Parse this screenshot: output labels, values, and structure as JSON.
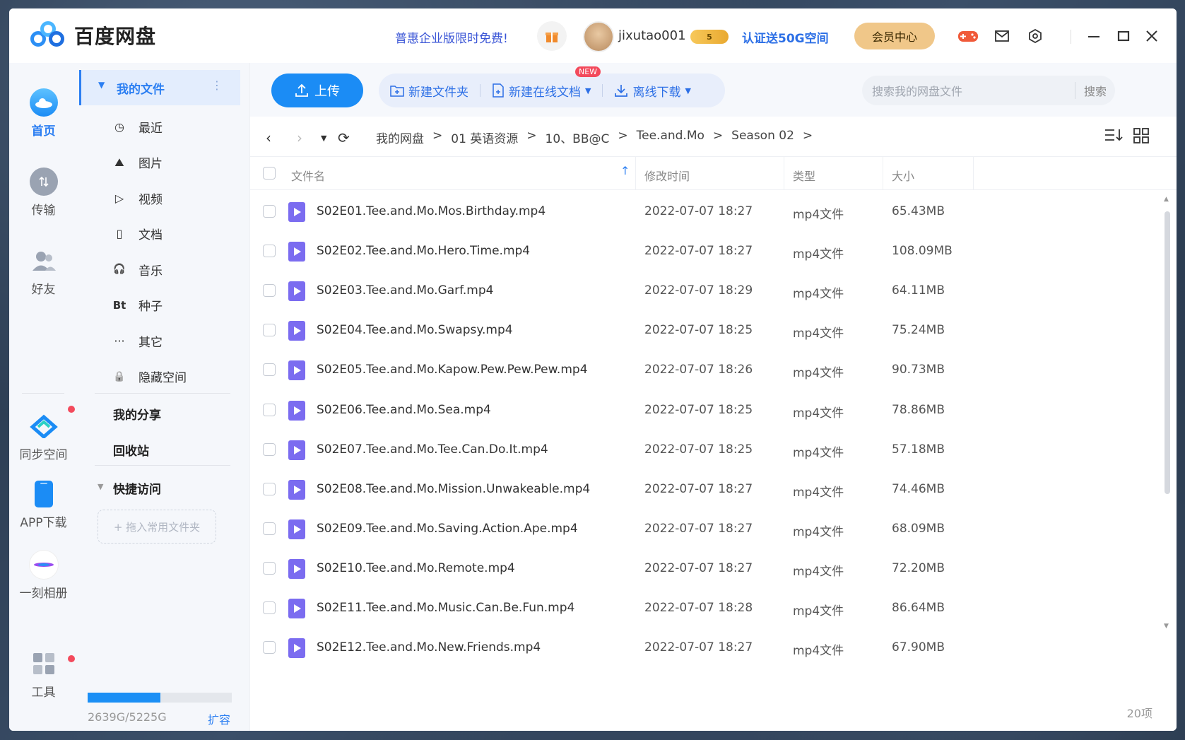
{
  "app": {
    "title": "百度网盘"
  },
  "header": {
    "promo": "普惠企业版限时免费!",
    "username": "jixutao001",
    "vip_level": "5",
    "cert_text": "认证送50G空间",
    "member_center": "会员中心"
  },
  "nav": {
    "home": "首页",
    "transfer": "传输",
    "friends": "好友",
    "sync": "同步空间",
    "app_download": "APP下载",
    "album": "一刻相册",
    "tools": "工具"
  },
  "sidebar": {
    "my_files": "我的文件",
    "items": [
      {
        "label": "最近",
        "icon": "clock-icon"
      },
      {
        "label": "图片",
        "icon": "image-icon"
      },
      {
        "label": "视频",
        "icon": "play-icon"
      },
      {
        "label": "文档",
        "icon": "document-icon"
      },
      {
        "label": "音乐",
        "icon": "headphones-icon"
      },
      {
        "label": "种子",
        "icon": "bt-icon"
      },
      {
        "label": "其它",
        "icon": "more-icon"
      },
      {
        "label": "隐藏空间",
        "icon": "lock-icon"
      }
    ],
    "my_share": "我的分享",
    "recycle": "回收站",
    "quick_access": "快捷访问",
    "drop_placeholder": "+ 拖入常用文件夹",
    "quota_text": "2639G/5225G",
    "quota_used_fraction": 0.505,
    "expand": "扩容"
  },
  "toolbar": {
    "upload": "上传",
    "new_folder": "新建文件夹",
    "new_doc": "新建在线文档",
    "new_badge": "NEW",
    "offline_download": "离线下载",
    "search_placeholder": "搜索我的网盘文件",
    "search_button": "搜索"
  },
  "breadcrumb": [
    "我的网盘",
    "01 英语资源",
    "10、BB@C",
    "Tee.and.Mo",
    "Season 02"
  ],
  "table": {
    "headers": {
      "name": "文件名",
      "modified": "修改时间",
      "type": "类型",
      "size": "大小"
    },
    "rows": [
      {
        "name": "S02E01.Tee.and.Mo.Mos.Birthday.mp4",
        "modified": "2022-07-07 18:27",
        "type": "mp4文件",
        "size": "65.43MB"
      },
      {
        "name": "S02E02.Tee.and.Mo.Hero.Time.mp4",
        "modified": "2022-07-07 18:27",
        "type": "mp4文件",
        "size": "108.09MB"
      },
      {
        "name": "S02E03.Tee.and.Mo.Garf.mp4",
        "modified": "2022-07-07 18:29",
        "type": "mp4文件",
        "size": "64.11MB"
      },
      {
        "name": "S02E04.Tee.and.Mo.Swapsy.mp4",
        "modified": "2022-07-07 18:25",
        "type": "mp4文件",
        "size": "75.24MB"
      },
      {
        "name": "S02E05.Tee.and.Mo.Kapow.Pew.Pew.Pew.mp4",
        "modified": "2022-07-07 18:26",
        "type": "mp4文件",
        "size": "90.73MB"
      },
      {
        "name": "S02E06.Tee.and.Mo.Sea.mp4",
        "modified": "2022-07-07 18:25",
        "type": "mp4文件",
        "size": "78.86MB"
      },
      {
        "name": "S02E07.Tee.and.Mo.Tee.Can.Do.It.mp4",
        "modified": "2022-07-07 18:25",
        "type": "mp4文件",
        "size": "57.18MB"
      },
      {
        "name": "S02E08.Tee.and.Mo.Mission.Unwakeable.mp4",
        "modified": "2022-07-07 18:27",
        "type": "mp4文件",
        "size": "74.46MB"
      },
      {
        "name": "S02E09.Tee.and.Mo.Saving.Action.Ape.mp4",
        "modified": "2022-07-07 18:27",
        "type": "mp4文件",
        "size": "68.09MB"
      },
      {
        "name": "S02E10.Tee.and.Mo.Remote.mp4",
        "modified": "2022-07-07 18:27",
        "type": "mp4文件",
        "size": "72.20MB"
      },
      {
        "name": "S02E11.Tee.and.Mo.Music.Can.Be.Fun.mp4",
        "modified": "2022-07-07 18:28",
        "type": "mp4文件",
        "size": "86.64MB"
      },
      {
        "name": "S02E12.Tee.and.Mo.New.Friends.mp4",
        "modified": "2022-07-07 18:27",
        "type": "mp4文件",
        "size": "67.90MB"
      }
    ],
    "count": "20项"
  },
  "colors": {
    "accent": "#1b8cf5",
    "file_icon": "#7b6cf0",
    "badge_red": "#f34a5c"
  }
}
